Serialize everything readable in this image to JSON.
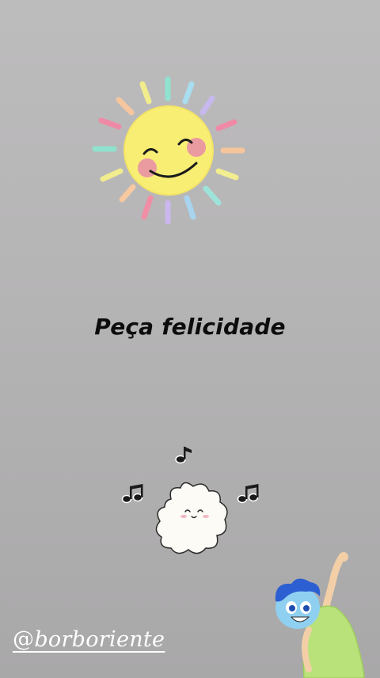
{
  "story": {
    "caption": "Peça felicidade",
    "username": "borboriente",
    "mention_symbol": "@"
  },
  "stickers": {
    "sun": "smiling-sun-sticker",
    "cloud": "dancing-cloud-sticker",
    "joy": "joy-character-sticker"
  },
  "colors": {
    "background": "#b6b5b6",
    "sun_face": "#f8ee74",
    "caption": "#0c0c0c",
    "handle": "#ffffff"
  }
}
